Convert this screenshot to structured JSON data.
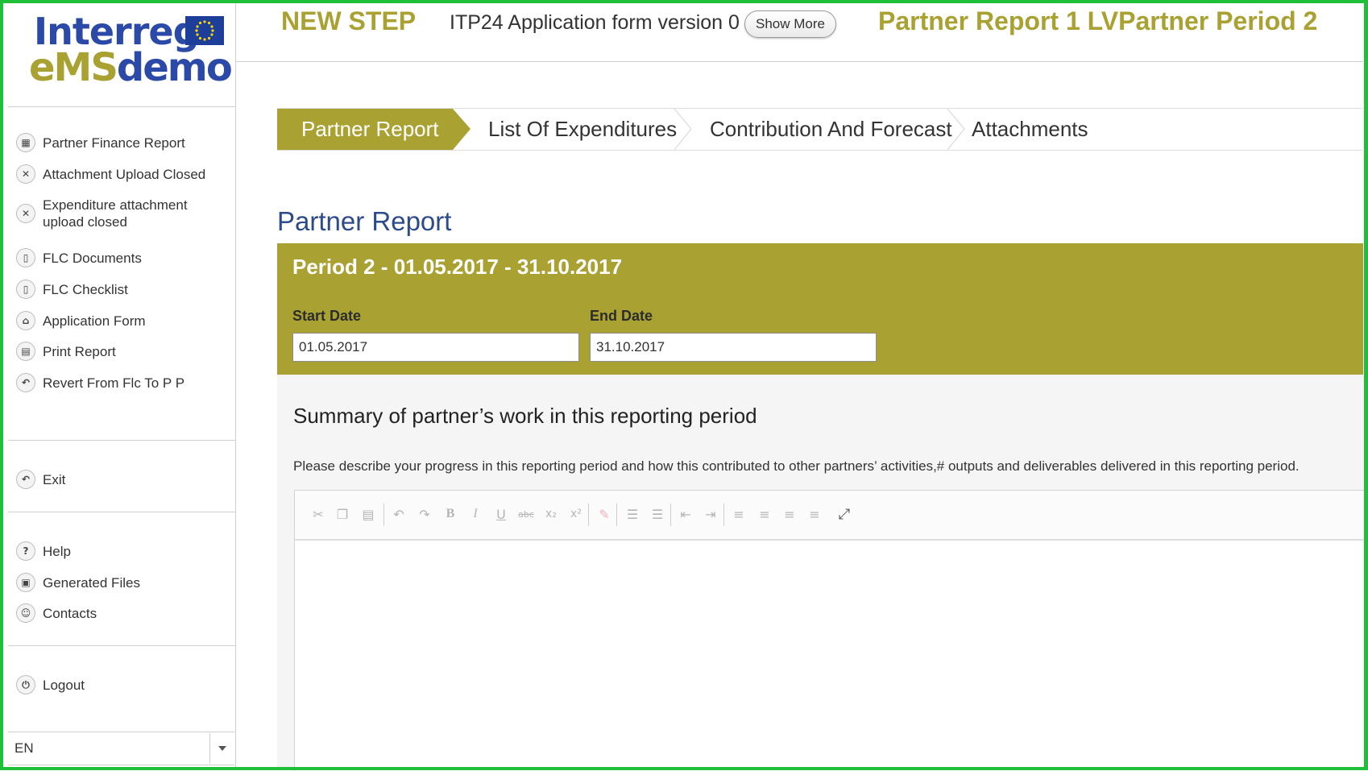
{
  "logo": {
    "line1": "Interreg",
    "ems": "eMS",
    "demo": "demo"
  },
  "header": {
    "step": "NEW STEP",
    "form_version": "ITP24 Application form version 0",
    "show_more": "Show More",
    "period_title": "Partner Report 1 LVPartner Period 2"
  },
  "sidebar": {
    "items": [
      {
        "label": "Partner Finance Report",
        "icon": "finance-icon"
      },
      {
        "label": "Attachment Upload Closed",
        "icon": "close-icon"
      },
      {
        "label": "Expenditure attachment upload closed",
        "icon": "close-icon"
      },
      {
        "label": "FLC Documents",
        "icon": "document-icon"
      },
      {
        "label": "FLC Checklist",
        "icon": "document-icon"
      },
      {
        "label": "Application Form",
        "icon": "building-icon"
      },
      {
        "label": "Print Report",
        "icon": "print-icon"
      },
      {
        "label": "Revert From Flc To P P",
        "icon": "revert-icon"
      }
    ],
    "exit": "Exit",
    "help": "Help",
    "generated_files": "Generated Files",
    "contacts": "Contacts",
    "logout": "Logout",
    "language": "EN"
  },
  "tabs": [
    {
      "label": "Partner Report",
      "active": true
    },
    {
      "label": "List Of Expenditures",
      "active": false
    },
    {
      "label": "Contribution And Forecast",
      "active": false
    },
    {
      "label": "Attachments",
      "active": false
    }
  ],
  "main": {
    "title": "Partner Report",
    "period_heading": "Period 2 - 01.05.2017 - 31.10.2017",
    "start_date_label": "Start Date",
    "start_date": "01.05.2017",
    "end_date_label": "End Date",
    "end_date": "31.10.2017",
    "summary_title": "Summary of partner’s work in this reporting period",
    "summary_desc": "Please describe your progress in this reporting period and how this contributed to other partners’ activities,# outputs and deliverables delivered in this reporting period."
  },
  "colors": {
    "accent": "#a9a232",
    "title_blue": "#2d4b8a",
    "frame_green": "#1fbf3a"
  }
}
